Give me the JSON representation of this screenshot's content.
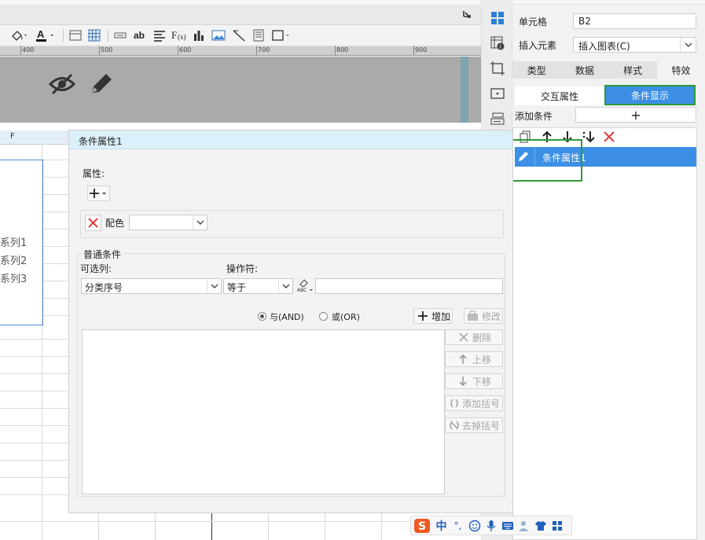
{
  "colors": {
    "accent": "#3d8fe6",
    "highlight_border": "#2e9a3a",
    "delete_red": "#e03a3a",
    "dialog_title_bg": "#daf0fa",
    "selection_blue": "#4a8fd6"
  },
  "toolbar": {
    "icons": [
      "paint-bucket-icon",
      "font-color-icon",
      "border-icon",
      "table-icon",
      "merge-icon",
      "text-ab-icon",
      "align-icon",
      "formula-icon",
      "bar-chart-icon",
      "image-icon",
      "slash-icon",
      "frame-icon",
      "border-style-icon"
    ]
  },
  "ruler": {
    "ticks": [
      "400",
      "500",
      "600",
      "700",
      "800",
      "900"
    ]
  },
  "sheet": {
    "column_header": "F",
    "series": [
      "系列1",
      "系列2",
      "系列3"
    ]
  },
  "right_panel": {
    "cell_label": "单元格",
    "cell_value": "B2",
    "insert_label": "插入元素",
    "insert_value": "插入图表(C)",
    "tabs": [
      "类型",
      "数据",
      "样式",
      "特效"
    ],
    "active_tab": "特效",
    "subtabs": {
      "interactive": "交互属性",
      "conditional": "条件显示"
    },
    "add_condition_label": "添加条件",
    "add_symbol": "+",
    "list_items": [
      "条件属性1"
    ]
  },
  "dialog": {
    "title": "条件属性1",
    "property_label": "属性:",
    "color_label": "配色",
    "color_value": "",
    "normal_condition_label": "普通条件",
    "column_label": "可选列:",
    "column_value": "分类序号",
    "operator_label": "操作符:",
    "operator_value": "等于",
    "value_field": "",
    "radio_and": "与(AND)",
    "radio_or": "或(OR)",
    "and_selected": true,
    "add_button": "增加",
    "modify_button": "修改",
    "delete_button": "删除",
    "up_button": "上移",
    "down_button": "下移",
    "add_bracket_button": "添加括号",
    "remove_bracket_button": "去掉括号"
  },
  "ime": {
    "lang": "中",
    "punct": "°,"
  }
}
